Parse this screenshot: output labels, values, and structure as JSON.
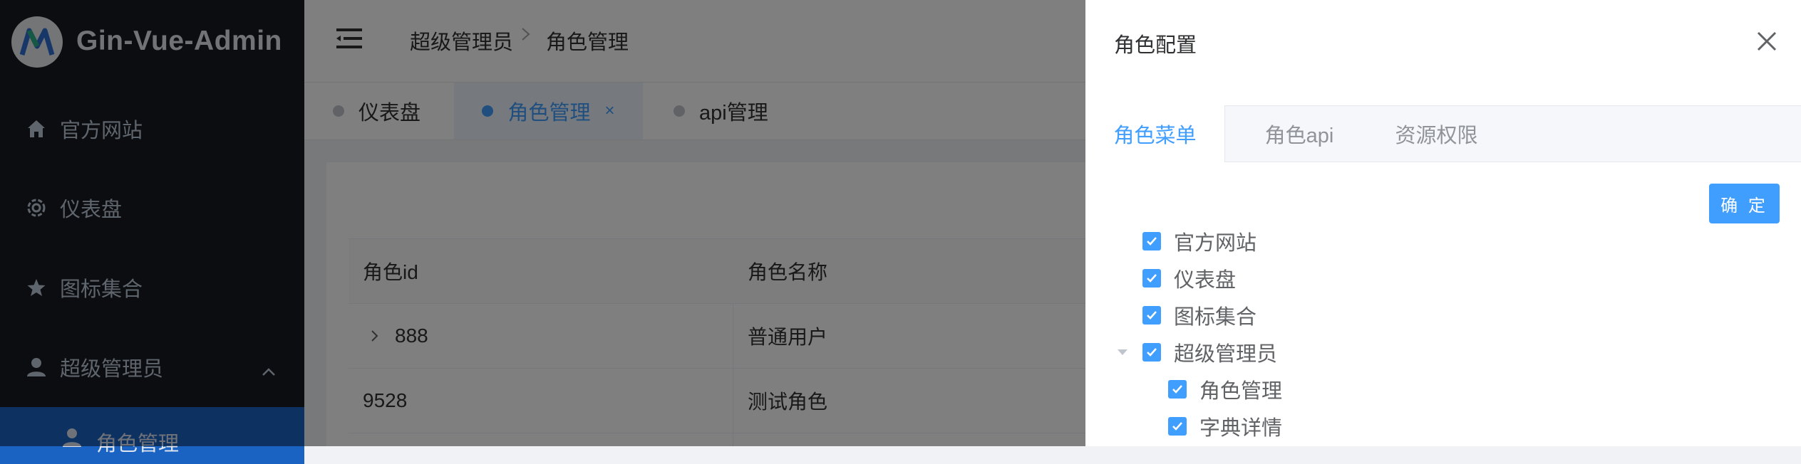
{
  "app": {
    "logo_text": "Gin-Vue-Admin"
  },
  "sidebar": {
    "items": [
      {
        "label": "官方网站",
        "icon": "home-icon"
      },
      {
        "label": "仪表盘",
        "icon": "gear-icon"
      },
      {
        "label": "图标集合",
        "icon": "star-icon"
      },
      {
        "label": "超级管理员",
        "icon": "user-icon",
        "expanded": true
      },
      {
        "label": "角色管理",
        "icon": "user-icon",
        "active": true
      }
    ]
  },
  "header": {
    "breadcrumb": [
      "超级管理员",
      "角色管理"
    ]
  },
  "tabs": [
    {
      "label": "仪表盘",
      "active": false
    },
    {
      "label": "角色管理",
      "active": true,
      "close": "×"
    },
    {
      "label": "api管理",
      "active": false
    }
  ],
  "table": {
    "columns": [
      "角色id",
      "角色名称"
    ],
    "rows": [
      {
        "id": "888",
        "name": "普通用户",
        "expandable": true
      },
      {
        "id": "9528",
        "name": "测试角色",
        "expandable": false
      }
    ]
  },
  "drawer": {
    "title": "角色配置",
    "tabs": [
      "角色菜单",
      "角色api",
      "资源权限"
    ],
    "active_tab": 0,
    "confirm_label": "确 定",
    "tree": [
      {
        "label": "官方网站",
        "checked": true,
        "level": 0
      },
      {
        "label": "仪表盘",
        "checked": true,
        "level": 0
      },
      {
        "label": "图标集合",
        "checked": true,
        "level": 0
      },
      {
        "label": "超级管理员",
        "checked": true,
        "level": 0,
        "expanded": true
      },
      {
        "label": "角色管理",
        "checked": true,
        "level": 1
      },
      {
        "label": "字典详情",
        "checked": true,
        "level": 1
      }
    ]
  },
  "colors": {
    "sidebar_bg": "#191a23",
    "accent": "#409eff",
    "active_menu": "#1b63c2"
  }
}
